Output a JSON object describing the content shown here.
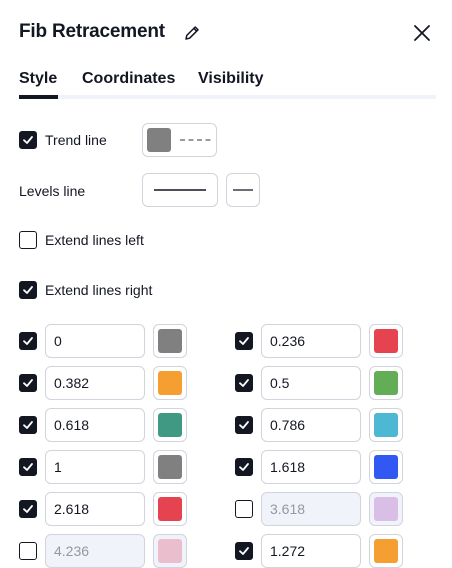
{
  "dialog": {
    "title": "Fib Retracement"
  },
  "tabs": [
    {
      "label": "Style",
      "active": true
    },
    {
      "label": "Coordinates",
      "active": false
    },
    {
      "label": "Visibility",
      "active": false
    }
  ],
  "trend_line": {
    "label": "Trend line",
    "checked": true,
    "color": "#808080"
  },
  "levels_line": {
    "label": "Levels line"
  },
  "extend_left": {
    "label": "Extend lines left",
    "checked": false
  },
  "extend_right": {
    "label": "Extend lines right",
    "checked": true
  },
  "levels": [
    {
      "value": "0",
      "checked": true,
      "color": "#808080"
    },
    {
      "value": "0.236",
      "checked": true,
      "color": "#e5434f"
    },
    {
      "value": "0.382",
      "checked": true,
      "color": "#f59f32"
    },
    {
      "value": "0.5",
      "checked": true,
      "color": "#63ad56"
    },
    {
      "value": "0.618",
      "checked": true,
      "color": "#409983"
    },
    {
      "value": "0.786",
      "checked": true,
      "color": "#4db8d4"
    },
    {
      "value": "1",
      "checked": true,
      "color": "#808080"
    },
    {
      "value": "1.618",
      "checked": true,
      "color": "#3258f3"
    },
    {
      "value": "2.618",
      "checked": true,
      "color": "#e5434f"
    },
    {
      "value": "3.618",
      "checked": false,
      "color": "#c791d6"
    },
    {
      "value": "4.236",
      "checked": false,
      "color": "#e891a9"
    },
    {
      "value": "1.272",
      "checked": true,
      "color": "#f59f32"
    }
  ]
}
